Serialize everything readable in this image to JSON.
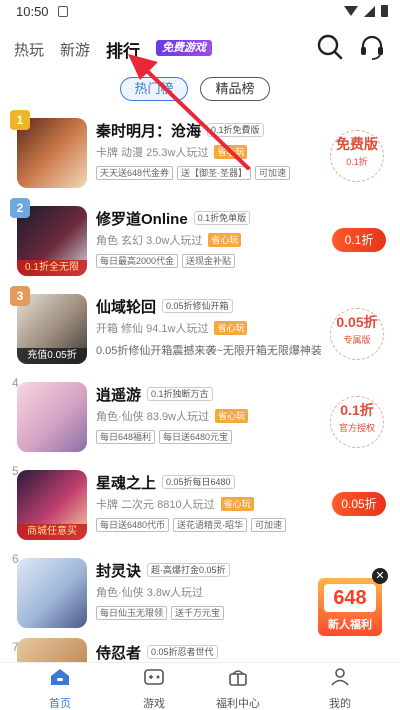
{
  "status_bar": {
    "time": "10:50"
  },
  "top_nav": {
    "tabs": [
      {
        "label": "热玩"
      },
      {
        "label": "新游"
      },
      {
        "label": "排行"
      }
    ],
    "free_game_badge": "免费游戏",
    "icons": [
      "search-icon",
      "headset-icon"
    ]
  },
  "rank_toggle": {
    "hot": "热门榜",
    "fine": "精品榜"
  },
  "games": [
    {
      "rank": "1",
      "name": "秦时明月：沧海",
      "sub": "0.1折免費版",
      "meta": "卡牌 动漫  25.3w人玩过",
      "worry": "省心玩",
      "chips": [
        "天天送648代金券",
        "送【御圣·圣器】",
        "可加速"
      ],
      "action": {
        "type": "seal",
        "big": "免费版",
        "small": "0.1折"
      }
    },
    {
      "rank": "2",
      "name": "修罗道Online",
      "sub": "0.1折免单版",
      "meta": "角色 玄幻  3.0w人玩过",
      "worry": "省心玩",
      "chips": [
        "每日最高2000代金",
        "送现金补贴"
      ],
      "cover_tag": "0.1折全无限",
      "action": {
        "type": "button",
        "label": "0.1折"
      }
    },
    {
      "rank": "3",
      "name": "仙域轮回",
      "sub": "0.05折修仙开箱",
      "meta": "开箱 修仙  94.1w人玩过",
      "worry": "省心玩",
      "desc": "0.05折修仙开箱震撼来袭~无限开箱无限爆神装",
      "cover_tag": "充值0.05折",
      "action": {
        "type": "seal",
        "big": "0.05折",
        "small": "专属版"
      }
    },
    {
      "rank": "4",
      "name": "逍遥游",
      "sub": "0.1折独断万古",
      "meta": "角色·仙侠  83.9w人玩过",
      "worry": "省心玩",
      "chips": [
        "每日648福利",
        "每日送6480元宝"
      ],
      "action": {
        "type": "seal",
        "big": "0.1折",
        "small": "官方授权"
      }
    },
    {
      "rank": "5",
      "name": "星魂之上",
      "sub": "0.05折每日6480",
      "meta": "卡牌 二次元  8810人玩过",
      "worry": "省心玩",
      "chips": [
        "每日送6480代币",
        "送花语精灵·昭华",
        "可加速"
      ],
      "cover_tag": "商城任意买",
      "action": {
        "type": "button",
        "label": "0.05折"
      }
    },
    {
      "rank": "6",
      "name": "封灵诀",
      "sub": "超·高爆打金0.05折",
      "meta": "角色·仙侠  3.8w人玩过",
      "chips": [
        "每日仙玉无限领",
        "送千万元宝"
      ],
      "action": {
        "type": "none"
      }
    },
    {
      "rank": "7",
      "name": "侍忍者",
      "sub": "0.05折忍者世代",
      "action": {
        "type": "none"
      }
    }
  ],
  "float_ad": {
    "amount": "648",
    "label": "新人福利"
  },
  "bottom_nav": [
    {
      "label": "首页",
      "icon": "home-icon"
    },
    {
      "label": "游戏",
      "icon": "gamepad-icon"
    },
    {
      "label": "福利中心",
      "icon": "gift-icon"
    },
    {
      "label": "我的",
      "icon": "profile-icon"
    }
  ],
  "colors": {
    "accent": "#3a7bd5",
    "price": "#e8341c",
    "arrow": "#e8283a"
  }
}
